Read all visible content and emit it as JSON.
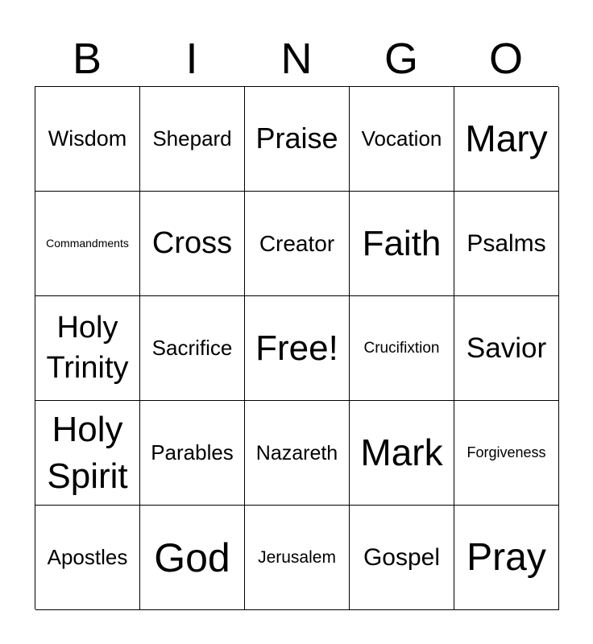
{
  "header": {
    "letters": [
      "B",
      "I",
      "N",
      "G",
      "O"
    ]
  },
  "board": {
    "rows": [
      [
        "Wisdom",
        "Shepard",
        "Praise",
        "Vocation",
        "Mary"
      ],
      [
        "Commandments",
        "Cross",
        "Creator",
        "Faith",
        "Psalms"
      ],
      [
        "Holy Trinity",
        "Sacrifice",
        "Free!",
        "Crucifixtion",
        "Savior"
      ],
      [
        "Holy Spirit",
        "Parables",
        "Nazareth",
        "Mark",
        "Forgiveness"
      ],
      [
        "Apostles",
        "God",
        "Jerusalem",
        "Gospel",
        "Pray"
      ]
    ]
  }
}
